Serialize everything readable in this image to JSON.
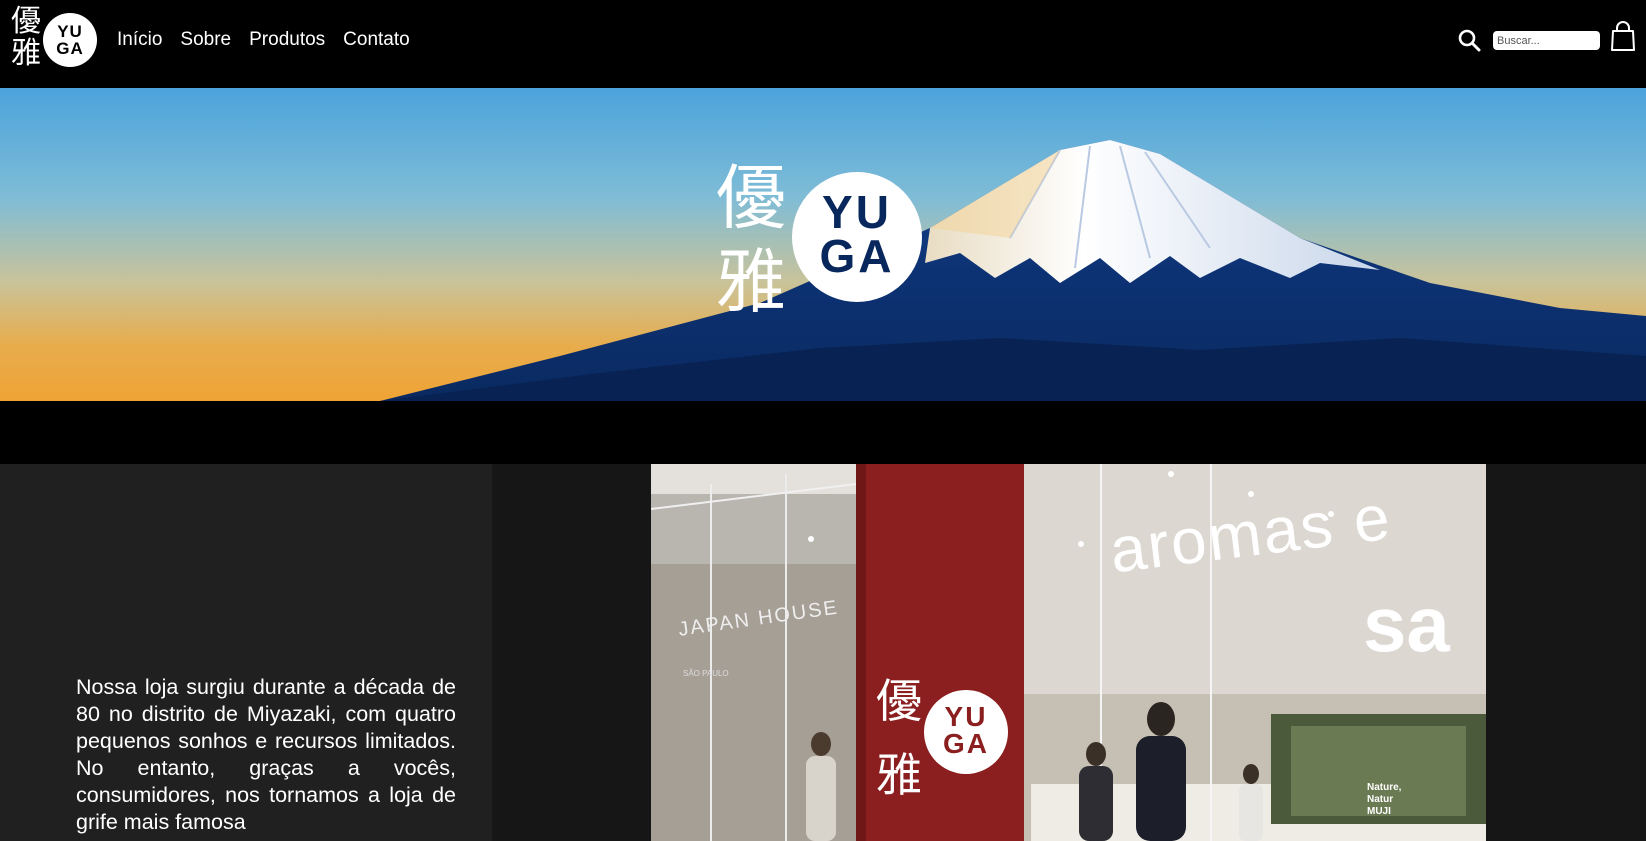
{
  "nav": {
    "logo": {
      "kanji_top": "優",
      "kanji_bottom": "雅",
      "circle_top": "YU",
      "circle_bottom": "GA"
    },
    "menu": [
      {
        "label": "Início"
      },
      {
        "label": "Sobre"
      },
      {
        "label": "Produtos"
      },
      {
        "label": "Contato"
      }
    ],
    "search": {
      "placeholder": "Buscar...",
      "value": "",
      "icon": "search-icon"
    },
    "cart": {
      "icon": "shopping-bag-icon"
    }
  },
  "hero": {
    "logo": {
      "kanji_top": "優",
      "kanji_bottom": "雅",
      "circle_top": "YU",
      "circle_bottom": "GA"
    }
  },
  "about": {
    "text": "Nossa loja surgiu durante a década de 80 no distrito de Miyazaki, com quatro pequenos sonhos e recursos limitados. No entanto, graças a vocês, consumidores, nos tornamos a loja de grife mais famosa",
    "photo": {
      "window_text": "aromas e",
      "window_text_bold": "sa",
      "store_name": "JAPAN HOUSE",
      "city": "SÃO PAULO",
      "nature_text": "Nature,\nNatur\nMUJI",
      "sign": {
        "kanji_top": "優",
        "kanji_bottom": "雅",
        "circle_top": "YU",
        "circle_bottom": "GA"
      }
    }
  },
  "colors": {
    "nav_bg": "#000000",
    "sky_top": "#4ba3dc",
    "sky_bottom": "#f0a335",
    "mountain": "#0a2d6b",
    "snow": "#f2f5fa",
    "about_bg": "#202020",
    "sign_red": "#8b1e1e"
  }
}
